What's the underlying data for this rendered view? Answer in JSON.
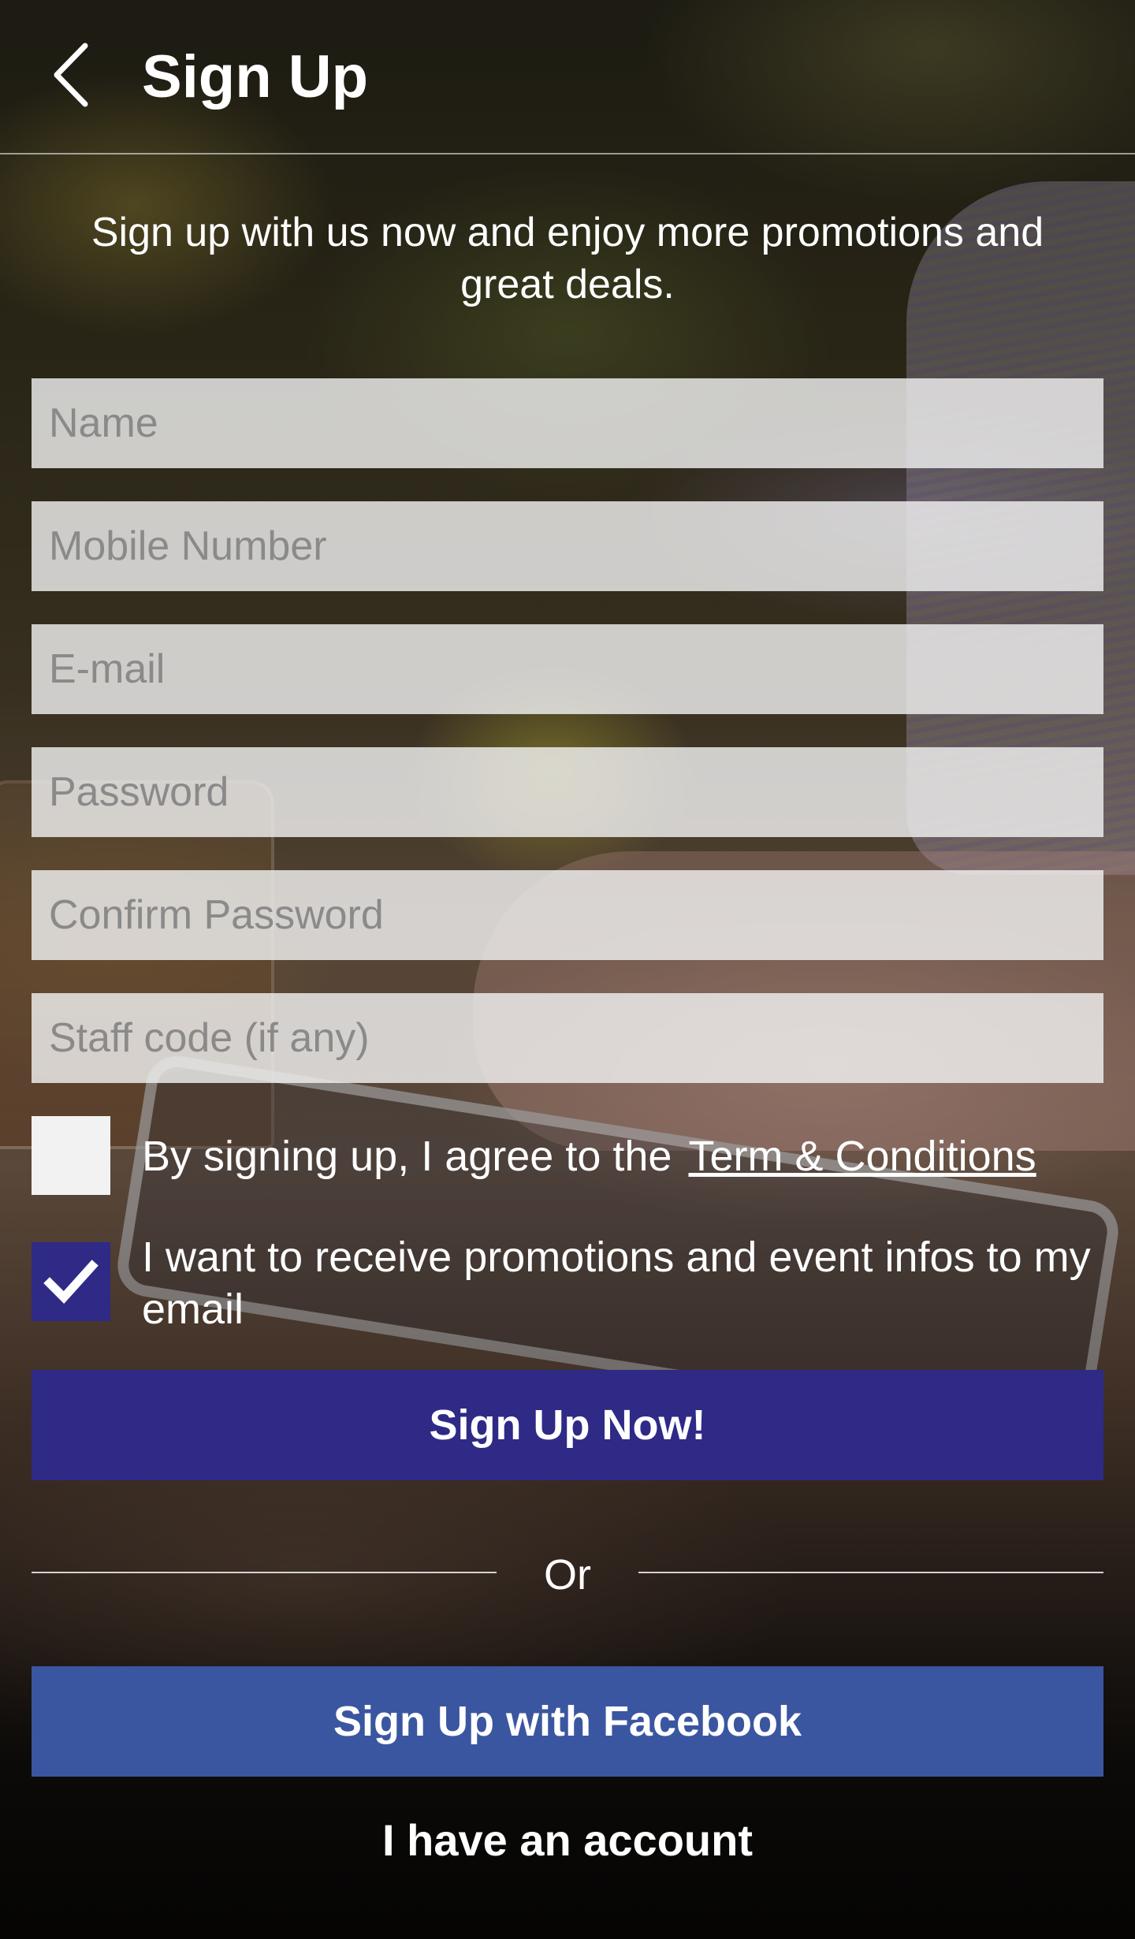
{
  "header": {
    "title": "Sign Up",
    "back_icon": "chevron-left-icon"
  },
  "intro_text": "Sign up with us now and enjoy more promotions and great deals.",
  "form": {
    "name_placeholder": "Name",
    "mobile_placeholder": "Mobile Number",
    "email_placeholder": "E-mail",
    "password_placeholder": "Password",
    "confirm_password_placeholder": "Confirm Password",
    "staff_code_placeholder": "Staff code (if any)"
  },
  "terms": {
    "checked": false,
    "text": "By signing up, I agree to the",
    "link_text": "Term & Conditions"
  },
  "promotions": {
    "checked": true,
    "text": "I want to receive promotions and event infos to my email",
    "check_icon": "checkmark-icon"
  },
  "buttons": {
    "signup_label": "Sign Up Now!",
    "facebook_label": "Sign Up with Facebook",
    "account_label": "I have an account"
  },
  "divider_text": "Or",
  "colors": {
    "primary": "#2e2a86",
    "facebook": "#3b56a0"
  }
}
